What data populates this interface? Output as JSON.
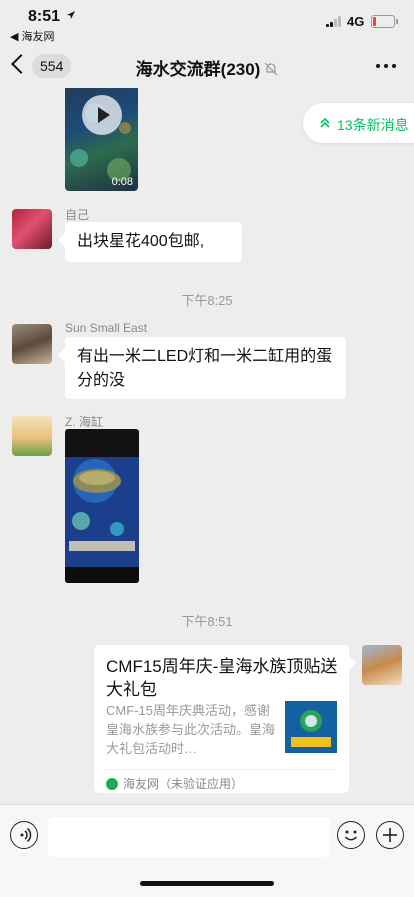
{
  "status_bar": {
    "time": "8:51",
    "back_app": "◀ 海友网",
    "network": "4G",
    "battery_level": 0.15
  },
  "nav": {
    "unread_count": "554",
    "title": "海水交流群(230)"
  },
  "new_messages": {
    "label": "13条新消息"
  },
  "messages": [
    {
      "type": "video",
      "duration": "0:08"
    },
    {
      "type": "text",
      "sender": "自己",
      "text": "出块星花400包邮,"
    },
    {
      "type": "timestamp",
      "text": "下午8:25"
    },
    {
      "type": "text",
      "sender": "Sun Small East",
      "text": "有出一米二LED灯和一米二缸用的蛋分的没"
    },
    {
      "type": "image",
      "sender": "Z. 海缸"
    },
    {
      "type": "timestamp",
      "text": "下午8:51"
    },
    {
      "type": "link_card",
      "title": "CMF15周年庆-皇海水族顶贴送大礼包",
      "description": "CMF-15周年庆典活动，感谢皇海水族参与此次活动。皇海大礼包活动时…",
      "source": "海友网（未验证应用）"
    }
  ],
  "colors": {
    "accent_green": "#07c160",
    "background": "#ededed",
    "bubble": "#ffffff"
  },
  "icons": [
    "back-chevron-icon",
    "mute-bell-icon",
    "more-icon",
    "double-up-arrow-icon",
    "play-icon",
    "voice-icon",
    "emoji-icon",
    "plus-icon"
  ]
}
